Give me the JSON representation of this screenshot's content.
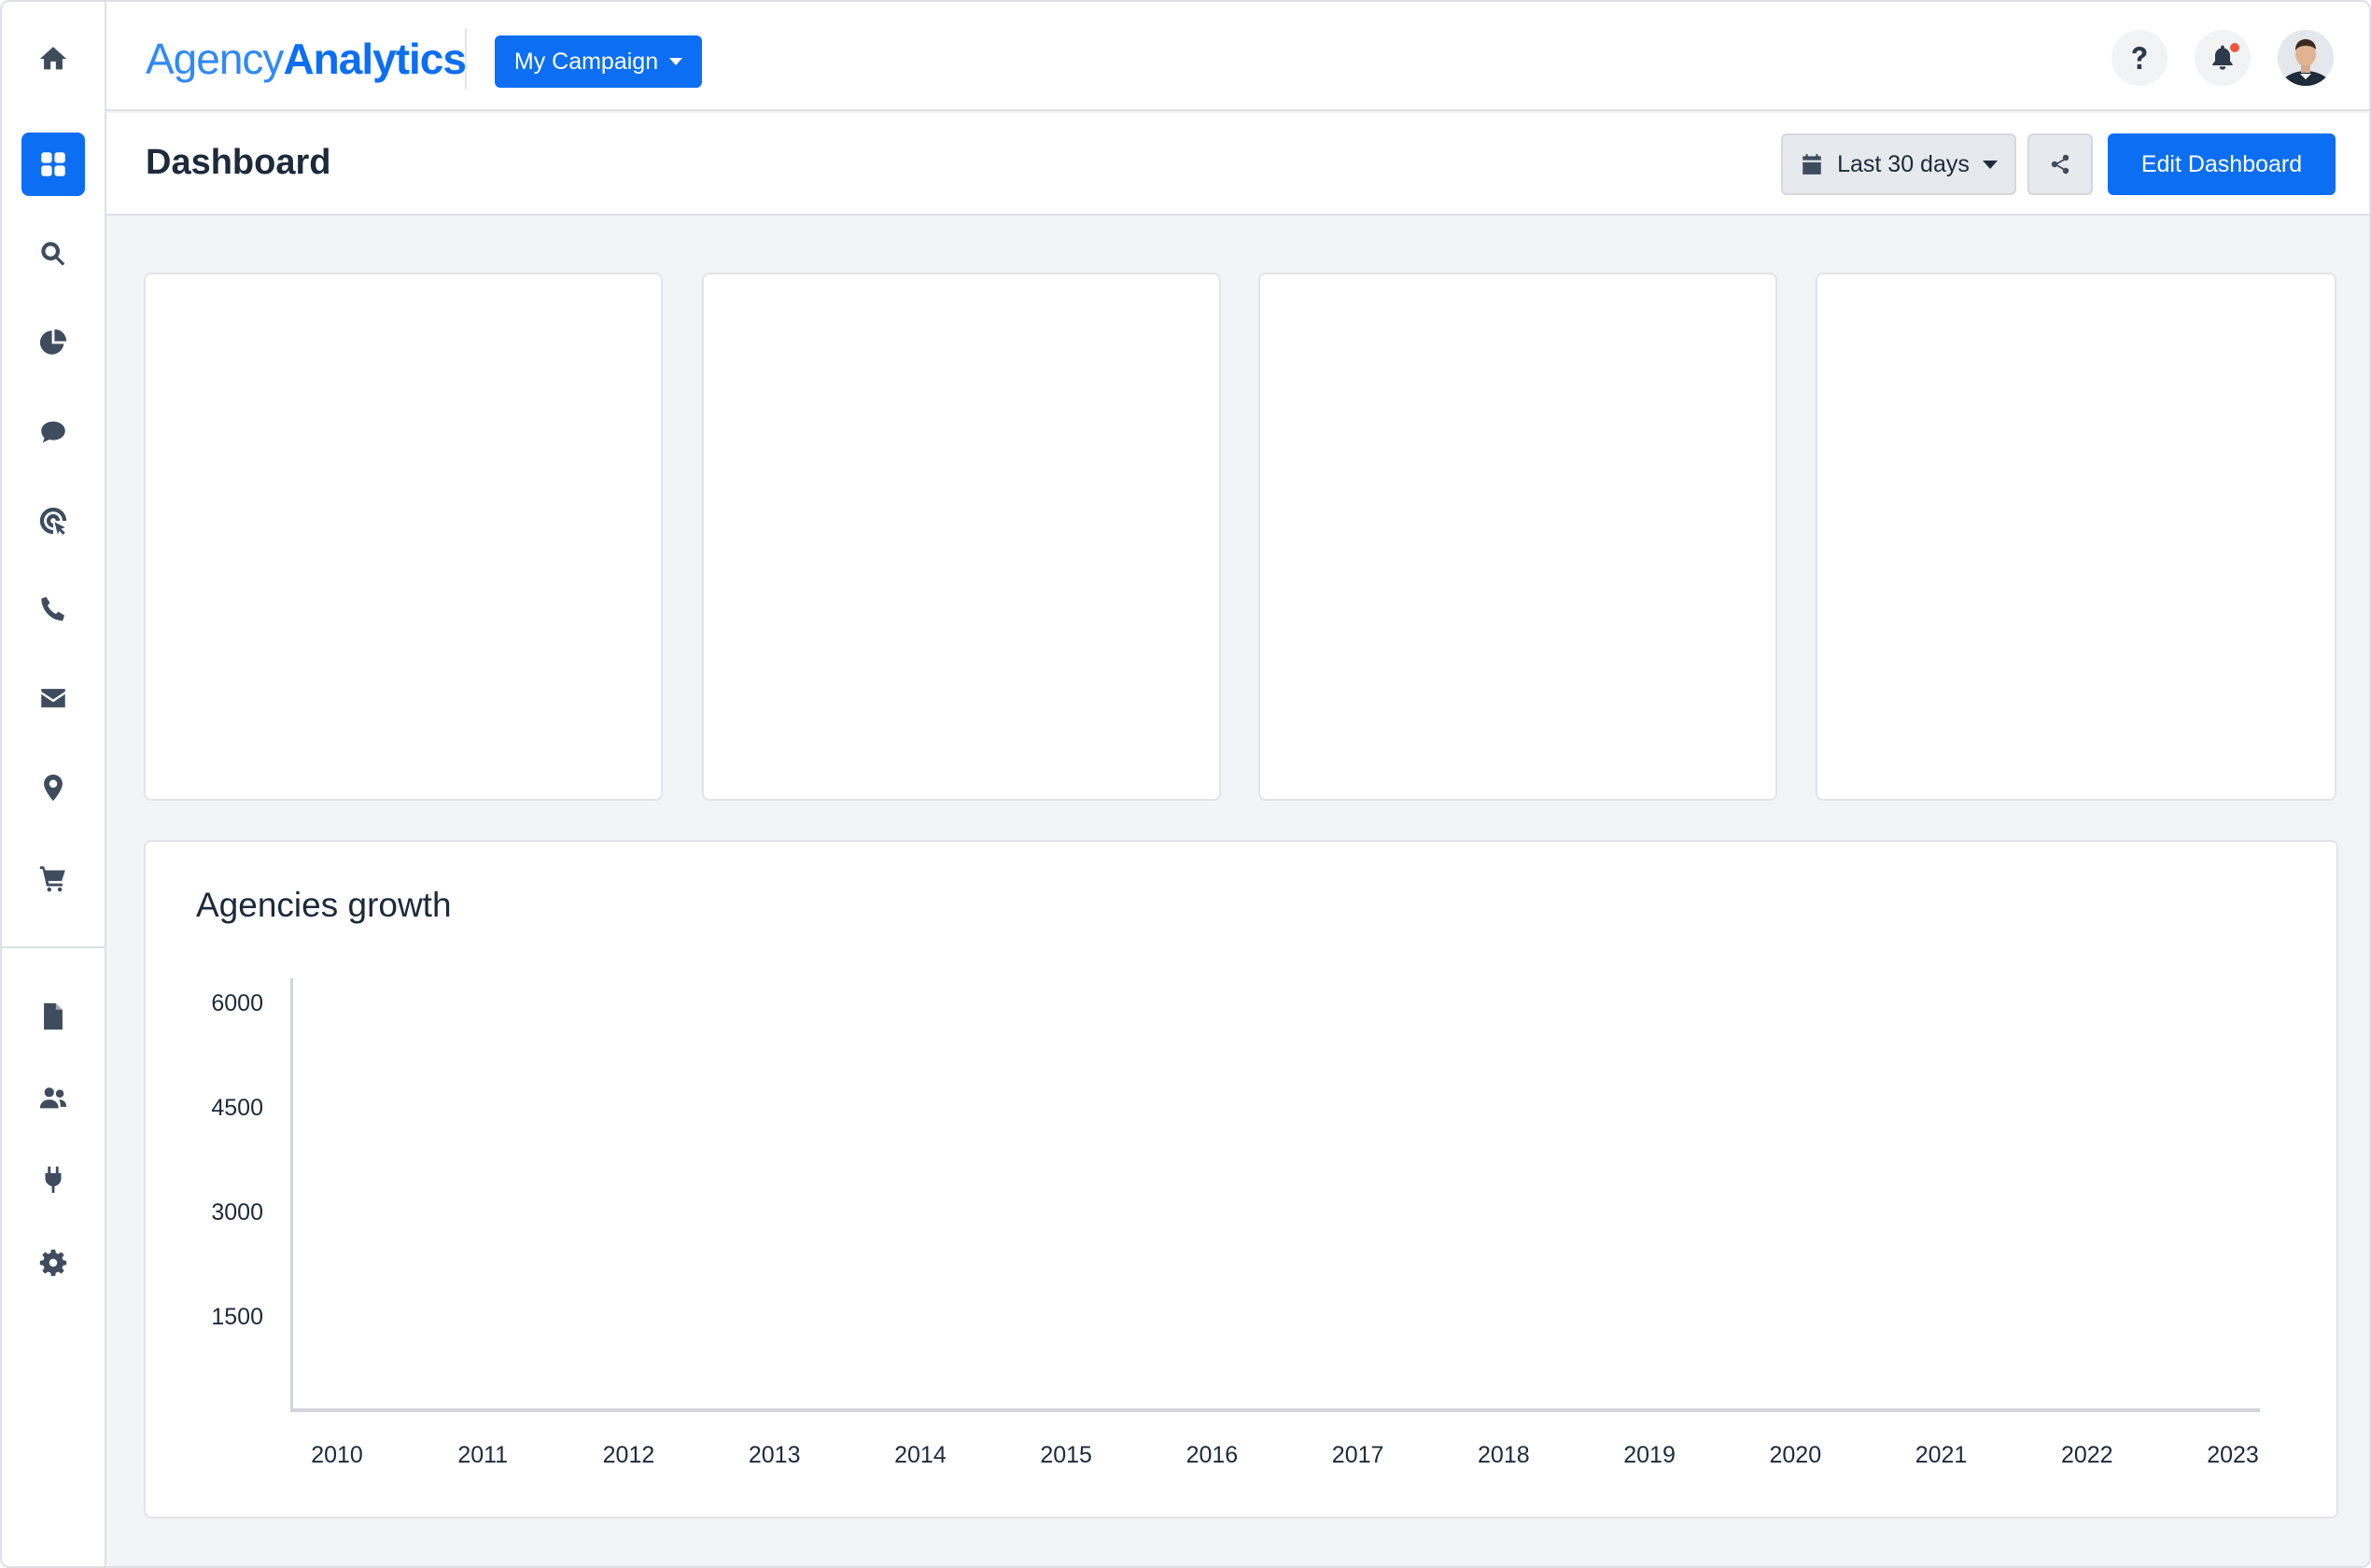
{
  "brand": {
    "name_light": "Agency",
    "name_bold": "Analytics",
    "accent": "#0b6ef3"
  },
  "topbar": {
    "campaign_label": "My Campaign",
    "help_icon": "question-icon",
    "notification_icon": "bell-icon",
    "avatar_icon": "user-avatar"
  },
  "sidebar": {
    "items": [
      {
        "name": "home",
        "icon": "home-icon"
      },
      {
        "name": "dashboard",
        "icon": "grid-icon",
        "active": true
      },
      {
        "name": "search",
        "icon": "search-icon"
      },
      {
        "name": "reports-pie",
        "icon": "pie-chart-icon"
      },
      {
        "name": "comments",
        "icon": "chat-icon"
      },
      {
        "name": "ads",
        "icon": "target-icon"
      },
      {
        "name": "calls",
        "icon": "phone-icon"
      },
      {
        "name": "email",
        "icon": "envelope-icon"
      },
      {
        "name": "location",
        "icon": "map-pin-icon"
      },
      {
        "name": "ecommerce",
        "icon": "cart-icon"
      },
      {
        "name": "documents",
        "icon": "file-icon"
      },
      {
        "name": "users",
        "icon": "users-icon"
      },
      {
        "name": "integrations",
        "icon": "plug-icon"
      },
      {
        "name": "settings",
        "icon": "gear-icon"
      }
    ]
  },
  "header": {
    "title": "Dashboard",
    "date_range": "Last 30 days",
    "share_icon": "share-icon",
    "edit_label": "Edit Dashboard"
  },
  "chart_data": {
    "type": "bar",
    "title": "Agencies growth",
    "categories": [
      "2010",
      "2011",
      "2012",
      "2013",
      "2014",
      "2015",
      "2016",
      "2017",
      "2018",
      "2019",
      "2020",
      "2021",
      "2022",
      "2023"
    ],
    "y_ticks": [
      "6000",
      "4500",
      "3000",
      "1500"
    ],
    "ylim": [
      0,
      6000
    ],
    "values": [],
    "grid": false
  }
}
